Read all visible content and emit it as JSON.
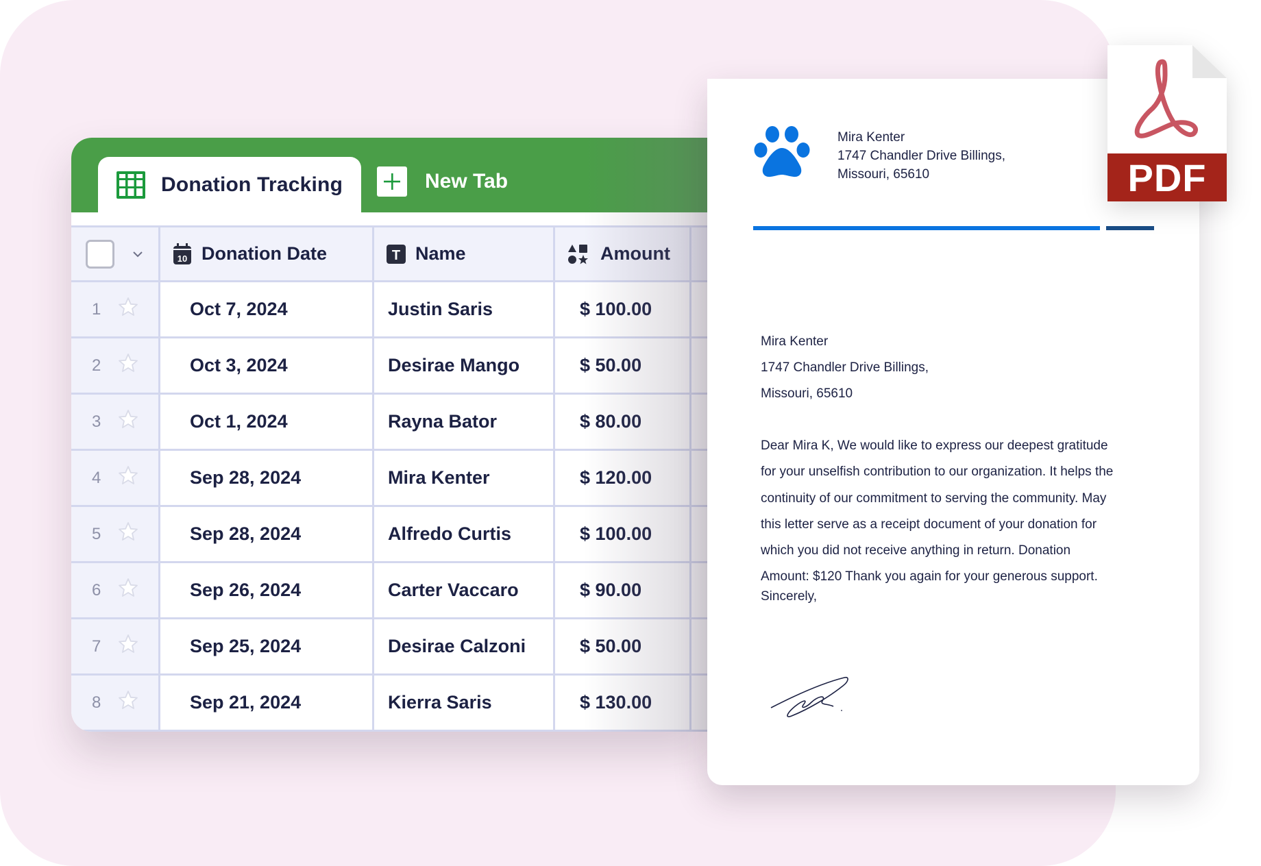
{
  "sheet": {
    "tabs": [
      {
        "label": "Donation Tracking",
        "icon": "grid-table-icon",
        "active": true
      },
      {
        "label": "New Tab",
        "icon": "plus-icon",
        "active": false
      }
    ],
    "columns": [
      {
        "label": "Donation Date",
        "icon": "calendar-icon",
        "icon_text": "10"
      },
      {
        "label": "Name",
        "icon": "text-type-icon",
        "icon_text": "T"
      },
      {
        "label": "Amount",
        "icon": "shapes-icon"
      }
    ],
    "rows": [
      {
        "num": "1",
        "date": "Oct 7, 2024",
        "name": "Justin Saris",
        "amount": "$ 100.00"
      },
      {
        "num": "2",
        "date": "Oct 3, 2024",
        "name": "Desirae Mango",
        "amount": "$ 50.00"
      },
      {
        "num": "3",
        "date": "Oct 1, 2024",
        "name": "Rayna Bator",
        "amount": "$ 80.00"
      },
      {
        "num": "4",
        "date": "Sep 28, 2024",
        "name": "Mira Kenter",
        "amount": "$ 120.00"
      },
      {
        "num": "5",
        "date": "Sep 28, 2024",
        "name": "Alfredo Curtis",
        "amount": "$ 100.00"
      },
      {
        "num": "6",
        "date": "Sep 26, 2024",
        "name": "Carter Vaccaro",
        "amount": "$ 90.00"
      },
      {
        "num": "7",
        "date": "Sep 25, 2024",
        "name": "Desirae Calzoni",
        "amount": "$ 50.00"
      },
      {
        "num": "8",
        "date": "Sep 21, 2024",
        "name": "Kierra Saris",
        "amount": "$ 130.00"
      }
    ],
    "colors": {
      "header_green": "#4a9e48",
      "grid_icon_green": "#1b9a3c",
      "text": "#1c2143"
    }
  },
  "letter": {
    "header": {
      "name": "Mira Kenter",
      "address_line1": "1747 Chandler Drive Billings,",
      "address_line2": "Missouri, 65610"
    },
    "recipient": {
      "name": "Mira Kenter",
      "address_line1": "1747 Chandler Drive Billings,",
      "address_line2": "Missouri, 65610"
    },
    "body_lines": [
      "Dear Mira K, We would like to express our deepest gratitude",
      "for your unselfish contribution to our organization. It helps the",
      "continuity of our commitment to serving the community. May",
      "this letter serve as a receipt document of your donation for",
      "which you did not receive anything in return. Donation",
      "Amount: $120 Thank you again for your generous support."
    ],
    "closing": "Sincerely,",
    "colors": {
      "paw_blue": "#0a74e0",
      "rule_blue": "#0a74e0",
      "rule_navy": "#1a4d86"
    }
  },
  "pdf_badge": {
    "label": "PDF",
    "color": "#a4241a",
    "logo_color": "#c85662"
  }
}
